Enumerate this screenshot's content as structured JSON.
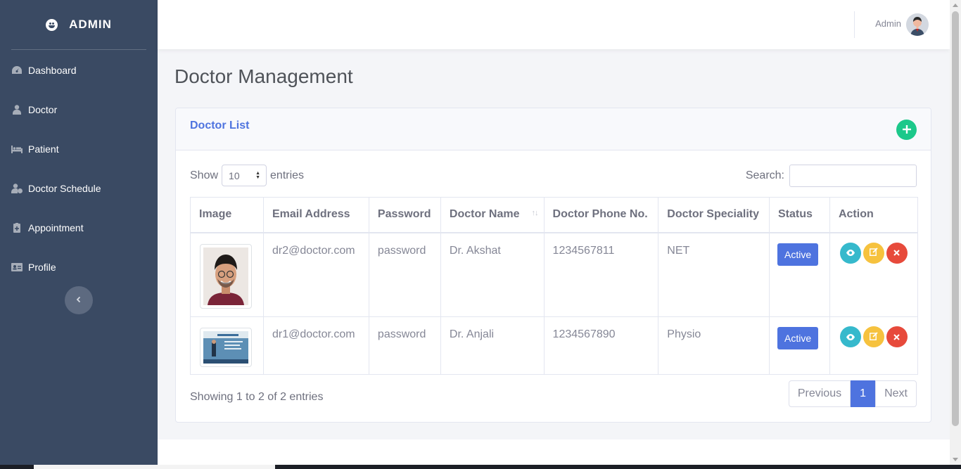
{
  "brand": {
    "title": "ADMIN"
  },
  "sidebar": {
    "items": [
      {
        "label": "Dashboard",
        "icon": "tachometer-icon"
      },
      {
        "label": "Doctor",
        "icon": "user-md-icon"
      },
      {
        "label": "Patient",
        "icon": "bed-icon"
      },
      {
        "label": "Doctor Schedule",
        "icon": "user-clock-icon"
      },
      {
        "label": "Appointment",
        "icon": "notes-medical-icon"
      },
      {
        "label": "Profile",
        "icon": "id-card-icon"
      }
    ],
    "toggle_icon": "chevron-left-icon"
  },
  "topbar": {
    "user_name": "Admin"
  },
  "page": {
    "title": "Doctor Management"
  },
  "card": {
    "title": "Doctor List",
    "show_label": "Show",
    "entries_value": "10",
    "entries_label": "entries",
    "search_label": "Search:",
    "search_value": ""
  },
  "table": {
    "headers": [
      "Image",
      "Email Address",
      "Password",
      "Doctor Name",
      "Doctor Phone No.",
      "Doctor Speciality",
      "Status",
      "Action"
    ],
    "rows": [
      {
        "email": "dr2@doctor.com",
        "password": "password",
        "name": "Dr. Akshat",
        "phone": "1234567811",
        "speciality": "NET",
        "status": "Active"
      },
      {
        "email": "dr1@doctor.com",
        "password": "password",
        "name": "Dr. Anjali",
        "phone": "1234567890",
        "speciality": "Physio",
        "status": "Active"
      }
    ]
  },
  "footer_info": "Showing 1 to 2 of 2 entries",
  "pagination": {
    "previous": "Previous",
    "current": "1",
    "next": "Next"
  },
  "colors": {
    "sidebar": "#3a4a63",
    "primary": "#4e73df",
    "success": "#1cc88a",
    "info": "#36b9cc",
    "warning": "#f6c23e",
    "danger": "#e74a3b"
  }
}
